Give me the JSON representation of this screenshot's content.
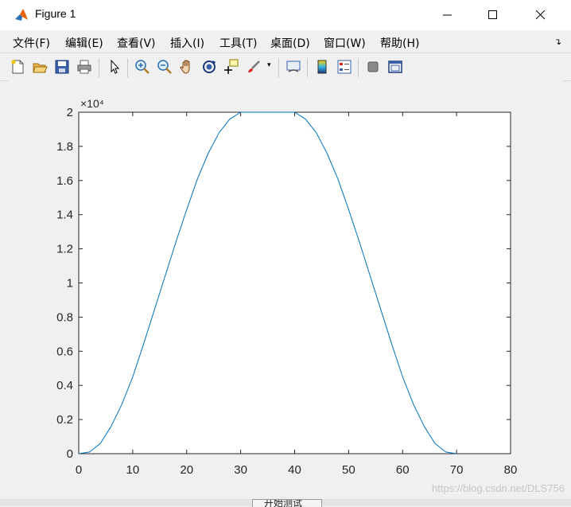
{
  "window": {
    "title": "Figure 1"
  },
  "menu": [
    {
      "label": "文件(F)"
    },
    {
      "label": "编辑(E)"
    },
    {
      "label": "查看(V)"
    },
    {
      "label": "插入(I)"
    },
    {
      "label": "工具(T)"
    },
    {
      "label": "桌面(D)"
    },
    {
      "label": "窗口(W)"
    },
    {
      "label": "帮助(H)"
    }
  ],
  "toolbar": [
    {
      "icon": "new-figure-icon"
    },
    {
      "icon": "open-file-icon"
    },
    {
      "icon": "save-icon"
    },
    {
      "icon": "print-icon"
    },
    {
      "icon": "select-cursor-icon"
    },
    {
      "icon": "zoom-in-icon"
    },
    {
      "icon": "zoom-out-icon"
    },
    {
      "icon": "pan-hand-icon"
    },
    {
      "icon": "rotate-3d-icon"
    },
    {
      "icon": "data-cursor-icon"
    },
    {
      "icon": "brush-icon"
    },
    {
      "icon": "link-plot-icon"
    },
    {
      "icon": "colorbar-icon"
    },
    {
      "icon": "legend-icon"
    },
    {
      "icon": "hide-plot-tools-icon"
    },
    {
      "icon": "show-plot-tools-icon"
    }
  ],
  "colors": {
    "line": "#0072bd",
    "axes_bg": "#ffffff",
    "figure_bg": "#f0f0f0"
  },
  "chart_data": {
    "type": "line",
    "xlim": [
      0,
      80
    ],
    "ylim": [
      0,
      20000
    ],
    "x_ticks": [
      "0",
      "10",
      "20",
      "30",
      "40",
      "50",
      "60",
      "70",
      "80"
    ],
    "y_ticks": [
      "0",
      "0.2",
      "0.4",
      "0.6",
      "0.8",
      "1",
      "1.2",
      "1.4",
      "1.6",
      "1.8",
      "2"
    ],
    "y_exponent_label": "×10⁴",
    "grid": false,
    "series": [
      {
        "x": [
          0,
          2,
          4,
          6,
          8,
          10,
          12,
          14,
          16,
          18,
          20,
          22,
          24,
          26,
          28,
          30,
          32,
          34,
          36,
          38,
          40,
          42,
          44,
          46,
          48,
          50,
          52,
          54,
          56,
          58,
          60,
          62,
          64,
          66,
          68,
          70
        ],
        "y": [
          0,
          100,
          600,
          1600,
          2900,
          4500,
          6400,
          8400,
          10400,
          12400,
          14300,
          16100,
          17600,
          18800,
          19600,
          20000,
          20000,
          20000,
          20000,
          20000,
          20000,
          19600,
          18800,
          17600,
          16100,
          14300,
          12400,
          10400,
          8400,
          6400,
          4500,
          2900,
          1600,
          600,
          100,
          0
        ]
      }
    ]
  },
  "footer": {
    "button_label": "开始测试"
  },
  "watermark": "https://blog.csdn.net/DLS756"
}
